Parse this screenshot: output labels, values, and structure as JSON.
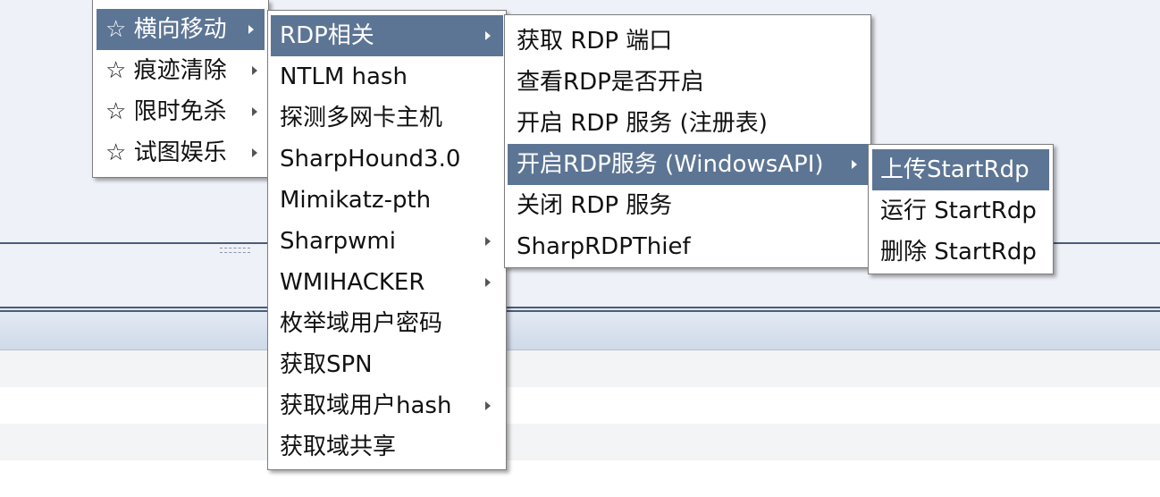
{
  "menu_level1": {
    "items": [
      {
        "label": "☆ 横向移动",
        "submenu": true,
        "selected": true
      },
      {
        "label": "☆ 痕迹清除",
        "submenu": true,
        "selected": false
      },
      {
        "label": "☆ 限时免杀",
        "submenu": true,
        "selected": false
      },
      {
        "label": "☆ 试图娱乐",
        "submenu": true,
        "selected": false
      }
    ]
  },
  "menu_level2": {
    "items": [
      {
        "label": "RDP相关",
        "submenu": true,
        "selected": true
      },
      {
        "label": "NTLM hash",
        "submenu": false
      },
      {
        "label": "探测多网卡主机",
        "submenu": false
      },
      {
        "label": "SharpHound3.0",
        "submenu": false
      },
      {
        "label": "Mimikatz-pth",
        "submenu": false
      },
      {
        "label": "Sharpwmi",
        "submenu": true
      },
      {
        "label": "WMIHACKER",
        "submenu": true
      },
      {
        "label": "枚举域用户密码",
        "submenu": false
      },
      {
        "label": "获取SPN",
        "submenu": false
      },
      {
        "label": "获取域用户hash",
        "submenu": true
      },
      {
        "label": "获取域共享",
        "submenu": false
      }
    ]
  },
  "menu_level3": {
    "items": [
      {
        "label": "获取 RDP 端口",
        "submenu": false
      },
      {
        "label": "查看RDP是否开启",
        "submenu": false
      },
      {
        "label": "开启 RDP 服务 (注册表)",
        "submenu": false
      },
      {
        "label": "开启RDP服务 (WindowsAPI)",
        "submenu": true,
        "selected": true
      },
      {
        "label": "关闭 RDP 服务",
        "submenu": false
      },
      {
        "label": "SharpRDPThief",
        "submenu": false
      }
    ]
  },
  "menu_level4": {
    "items": [
      {
        "label": "上传StartRdp",
        "selected": true
      },
      {
        "label": "运行 StartRdp"
      },
      {
        "label": "删除 StartRdp"
      }
    ]
  },
  "colors": {
    "selected_bg": "#5d7594",
    "app_bg": "#eef1f7",
    "separator": "#4a5d7a"
  }
}
